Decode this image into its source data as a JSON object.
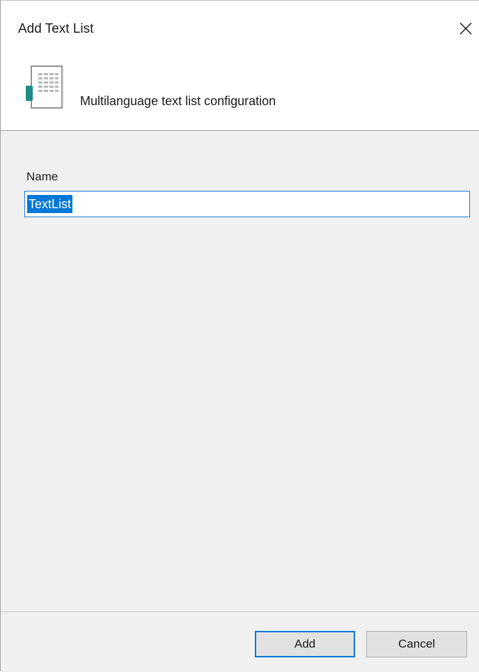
{
  "window": {
    "title": "Add Text List",
    "close_icon": "close-icon"
  },
  "header": {
    "icon": "document-list-icon",
    "description": "Multilanguage text list configuration"
  },
  "form": {
    "name_label": "Name",
    "name_value": "TextList"
  },
  "footer": {
    "add_label": "Add",
    "cancel_label": "Cancel"
  },
  "colors": {
    "accent": "#0078d7",
    "content_bg": "#f0f0f0",
    "icon_teal": "#1f8a87"
  }
}
